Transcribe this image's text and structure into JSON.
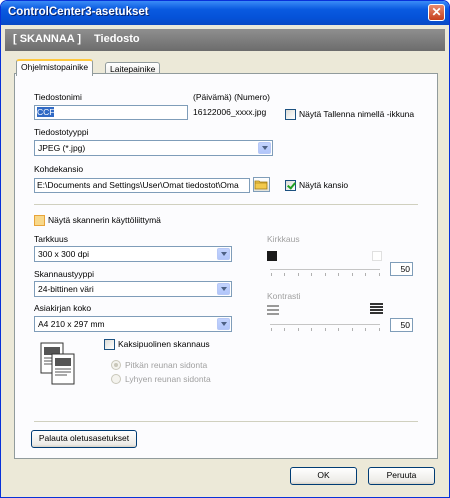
{
  "window": {
    "title": "ControlCenter3-asetukset"
  },
  "header": {
    "section": "[ SKANNAA ]",
    "subtitle": "Tiedosto"
  },
  "tabs": [
    {
      "label": "Ohjelmistopainike",
      "active": true
    },
    {
      "label": "Laitepainike",
      "active": false
    }
  ],
  "file": {
    "name_label": "Tiedostonimi",
    "name_value": "CCF",
    "date_hint_label": "(Päivämä) (Numero)",
    "date_hint_value": "16122006_xxxx.jpg",
    "show_save_as_label": "Näytä Tallenna nimellä -ikkuna",
    "show_save_as_checked": false,
    "type_label": "Tiedostotyyppi",
    "type_value": "JPEG (*.jpg)",
    "dest_label": "Kohdekansio",
    "dest_value": "E:\\Documents and Settings\\User\\Omat tiedostot\\Oma",
    "show_folder_label": "Näytä kansio",
    "show_folder_checked": true
  },
  "scanner": {
    "show_ui_label": "Näytä skannerin käyttöliittymä",
    "show_ui_checked": false,
    "resolution_label": "Tarkkuus",
    "resolution_value": "300 x 300 dpi",
    "scan_type_label": "Skannaustyyppi",
    "scan_type_value": "24-bittinen väri",
    "doc_size_label": "Asiakirjan koko",
    "doc_size_value": "A4 210 x 297 mm",
    "brightness_label": "Kirkkaus",
    "brightness_value": "50",
    "contrast_label": "Kontrasti",
    "contrast_value": "50",
    "duplex_label": "Kaksipuolinen skannaus",
    "duplex_checked": false,
    "long_edge_label": "Pitkän reunan sidonta",
    "short_edge_label": "Lyhyen reunan sidonta"
  },
  "buttons": {
    "restore": "Palauta oletusasetukset",
    "ok": "OK",
    "cancel": "Peruuta"
  },
  "colors": {
    "accent": "#0a5ae0",
    "header_band": "#7c7c7c"
  },
  "icons": {
    "close": "close-icon",
    "browse": "folder-icon",
    "brightness_low": "dark-square-icon",
    "brightness_high": "light-square-icon",
    "contrast_low": "low-contrast-icon",
    "contrast_high": "high-contrast-icon",
    "duplex": "duplex-pages-icon"
  }
}
